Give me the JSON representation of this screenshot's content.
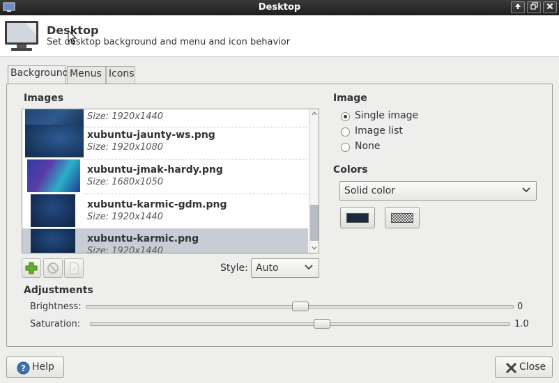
{
  "window": {
    "title": "Desktop"
  },
  "header": {
    "title": "Desktop",
    "subtitle": "Set desktop background and menu and icon behavior"
  },
  "tabs": [
    {
      "label": "Background",
      "active": true
    },
    {
      "label": "Menus",
      "active": false
    },
    {
      "label": "Icons",
      "active": false
    }
  ],
  "images_section": {
    "heading": "Images",
    "rows": [
      {
        "name": "",
        "size": "Size: 1920x1440",
        "selected": false
      },
      {
        "name": "xubuntu-jaunty-ws.png",
        "size": "Size: 1920x1080",
        "selected": false
      },
      {
        "name": "xubuntu-jmak-hardy.png",
        "size": "Size: 1680x1050",
        "selected": false
      },
      {
        "name": "xubuntu-karmic-gdm.png",
        "size": "Size: 1920x1440",
        "selected": false
      },
      {
        "name": "xubuntu-karmic.png",
        "size": "Size: 1920x1440",
        "selected": true
      }
    ],
    "style_label": "Style:",
    "style_value": "Auto"
  },
  "image_section": {
    "heading": "Image",
    "options": [
      {
        "label": "Single image",
        "checked": true
      },
      {
        "label": "Image list",
        "checked": false
      },
      {
        "label": "None",
        "checked": false
      }
    ]
  },
  "colors_section": {
    "heading": "Colors",
    "color_mode": "Solid color",
    "primary_color": "#1a2a3e",
    "secondary_pattern": "checker"
  },
  "adjustments": {
    "heading": "Adjustments",
    "brightness_label": "Brightness:",
    "brightness_value": "0",
    "brightness_level": 0.5,
    "saturation_label": "Saturation:",
    "saturation_value": "1.0",
    "saturation_level": 0.55
  },
  "buttons": {
    "help": "Help",
    "close": "Close"
  }
}
